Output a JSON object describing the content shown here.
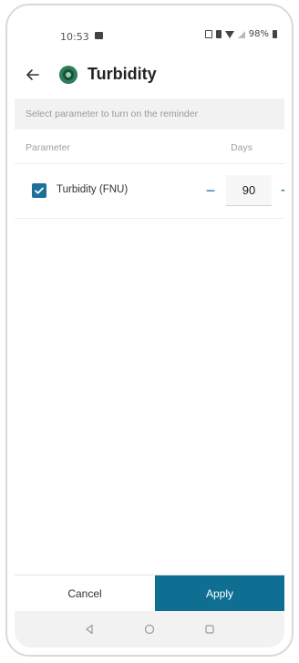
{
  "status_bar": {
    "time": "10:53",
    "battery_percent": "98%",
    "icons": [
      "message-icon",
      "nfc-icon",
      "vibrate-icon",
      "wifi-icon",
      "signal-icon",
      "battery-icon"
    ]
  },
  "header": {
    "title": "Turbidity",
    "back_icon": "arrow-left-icon",
    "app_icon": "sensor-icon"
  },
  "hint": "Select parameter to turn on the reminder",
  "table": {
    "columns": [
      "Parameter",
      "Days"
    ],
    "rows": [
      {
        "label": "Turbidity (FNU)",
        "checked": true,
        "days": "90"
      }
    ]
  },
  "stepper": {
    "minus": "−",
    "plus": "+"
  },
  "footer": {
    "cancel_label": "Cancel",
    "apply_label": "Apply"
  },
  "nav": {
    "icons": [
      "back-icon",
      "home-icon",
      "recents-icon"
    ]
  },
  "colors": {
    "accent": "#1f6f99",
    "apply_bg": "#0f6f93",
    "hint_bg": "#f2f2f2"
  }
}
